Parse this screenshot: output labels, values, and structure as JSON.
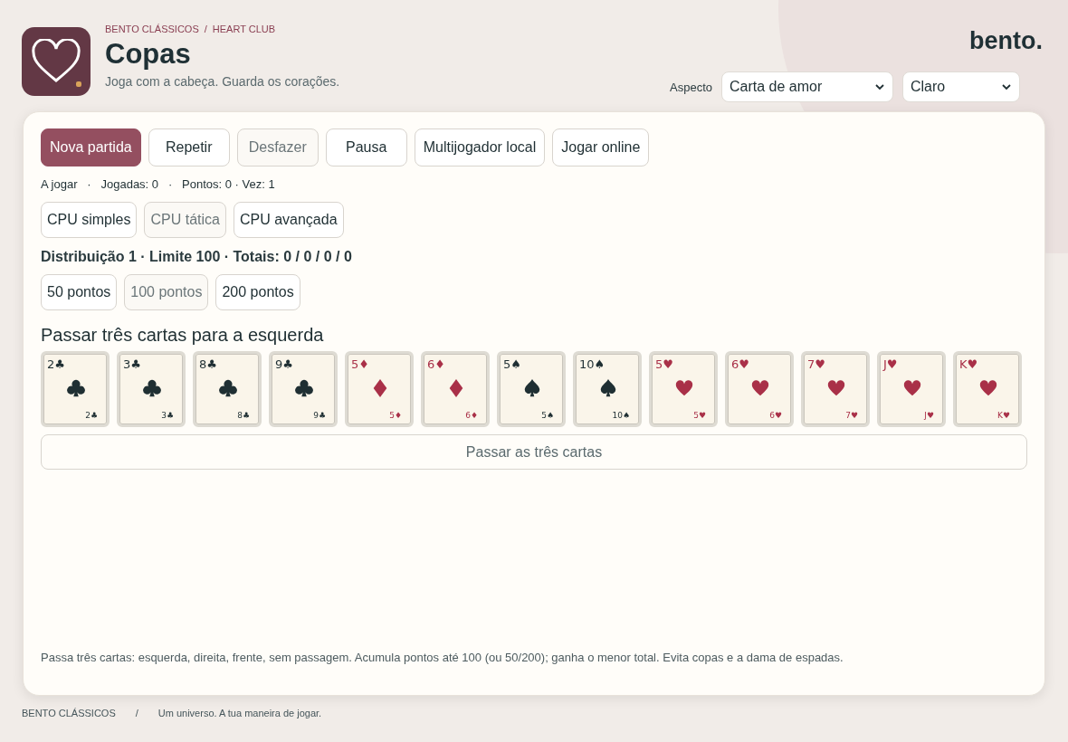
{
  "header": {
    "breadcrumb": [
      "BENTO CLÁSSICOS",
      "/",
      "HEART CLUB"
    ],
    "title": "Copas",
    "subtitle": "Joga com a cabeça. Guarda os corações.",
    "brand": "bento.",
    "aspect_label": "Aspecto",
    "selects": [
      {
        "value": "Carta de amor"
      },
      {
        "value": "Claro"
      }
    ]
  },
  "actions": [
    {
      "label": "Nova partida",
      "kind": "primary",
      "disabled": false
    },
    {
      "label": "Repetir",
      "kind": "normal",
      "disabled": false
    },
    {
      "label": "Desfazer",
      "kind": "normal",
      "disabled": true
    },
    {
      "label": "Pausa",
      "kind": "normal",
      "disabled": false
    },
    {
      "label": "Multijogador local",
      "kind": "normal",
      "disabled": false
    },
    {
      "label": "Jogar online",
      "kind": "normal",
      "disabled": false
    }
  ],
  "status": "A jogar   ·   Jogadas: 0   ·   Pontos: 0 · Vez: 1",
  "cpu_levels": [
    {
      "label": "CPU simples",
      "selected": false
    },
    {
      "label": "CPU tática",
      "selected": true
    },
    {
      "label": "CPU avançada",
      "selected": false
    }
  ],
  "round_info": "Distribuição 1 · Limite 100 · Totais: 0 / 0 / 0 / 0",
  "limits": [
    {
      "label": "50 pontos",
      "selected": false
    },
    {
      "label": "100 pontos",
      "selected": true
    },
    {
      "label": "200 pontos",
      "selected": false
    }
  ],
  "pass_title": "Passar três cartas para a esquerda",
  "hand": [
    {
      "corner": "2♣",
      "corner_small": "2♣",
      "kind": "clubs"
    },
    {
      "corner": "3♣",
      "corner_small": "3♣",
      "kind": "clubs"
    },
    {
      "corner": "8♣",
      "corner_small": "8♣",
      "kind": "clubs"
    },
    {
      "corner": "9♣",
      "corner_small": "9♣",
      "kind": "clubs"
    },
    {
      "corner": "5♦",
      "corner_small": "5♦",
      "kind": "diamonds"
    },
    {
      "corner": "6♦",
      "corner_small": "6♦",
      "kind": "diamonds"
    },
    {
      "corner": "5♠",
      "corner_small": "5♠",
      "kind": "spades"
    },
    {
      "corner": "10♠",
      "corner_small": "10♠",
      "kind": "spades"
    },
    {
      "corner": "5♥",
      "corner_small": "5♥",
      "kind": "hearts"
    },
    {
      "corner": "6♥",
      "corner_small": "6♥",
      "kind": "hearts"
    },
    {
      "corner": "7♥",
      "corner_small": "7♥",
      "kind": "hearts"
    },
    {
      "corner": "J♥",
      "corner_small": "J♥",
      "kind": "hearts"
    },
    {
      "corner": "K♥",
      "corner_small": "K♥",
      "kind": "hearts"
    }
  ],
  "pass_button": "Passar as três cartas",
  "rules": "Passa três cartas: esquerda, direita, frente, sem passagem. Acumula pontos até 100 (ou 50/200); ganha o menor total. Evita copas e a dama de espadas.",
  "footer": [
    "BENTO CLÁSSICOS",
    "/",
    "Um universo. A tua maneira de jogar."
  ]
}
